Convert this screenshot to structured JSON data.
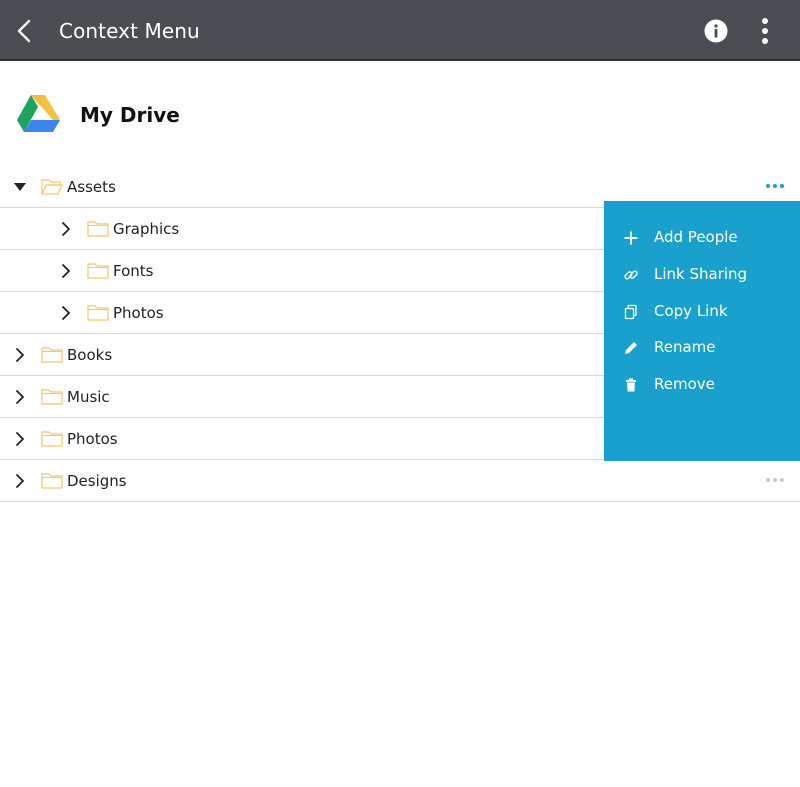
{
  "appbar": {
    "title": "Context Menu",
    "back_icon": "chevron-left-icon",
    "info_icon": "info-icon",
    "more_icon": "more-vert-icon",
    "background": "#4a4d52"
  },
  "drive": {
    "title": "My Drive",
    "logo_icon": "google-drive-logo"
  },
  "tree": {
    "folder_color": "#f0c96a",
    "rows": [
      {
        "label": "Assets",
        "expanded": true,
        "level": 0
      },
      {
        "label": "Graphics",
        "expanded": false,
        "level": 1
      },
      {
        "label": "Fonts",
        "expanded": false,
        "level": 1
      },
      {
        "label": "Photos",
        "expanded": false,
        "level": 1
      },
      {
        "label": "Books",
        "expanded": false,
        "level": 0
      },
      {
        "label": "Music",
        "expanded": false,
        "level": 0
      },
      {
        "label": "Photos",
        "expanded": false,
        "level": 0
      },
      {
        "label": "Designs",
        "expanded": false,
        "level": 0
      }
    ]
  },
  "context_menu": {
    "background": "#1aa0cd",
    "items": [
      {
        "label": "Add People",
        "icon": "plus-icon"
      },
      {
        "label": "Link Sharing",
        "icon": "link-icon"
      },
      {
        "label": "Copy Link",
        "icon": "copy-icon"
      },
      {
        "label": "Rename",
        "icon": "pencil-icon"
      },
      {
        "label": "Remove",
        "icon": "trash-icon"
      }
    ]
  }
}
